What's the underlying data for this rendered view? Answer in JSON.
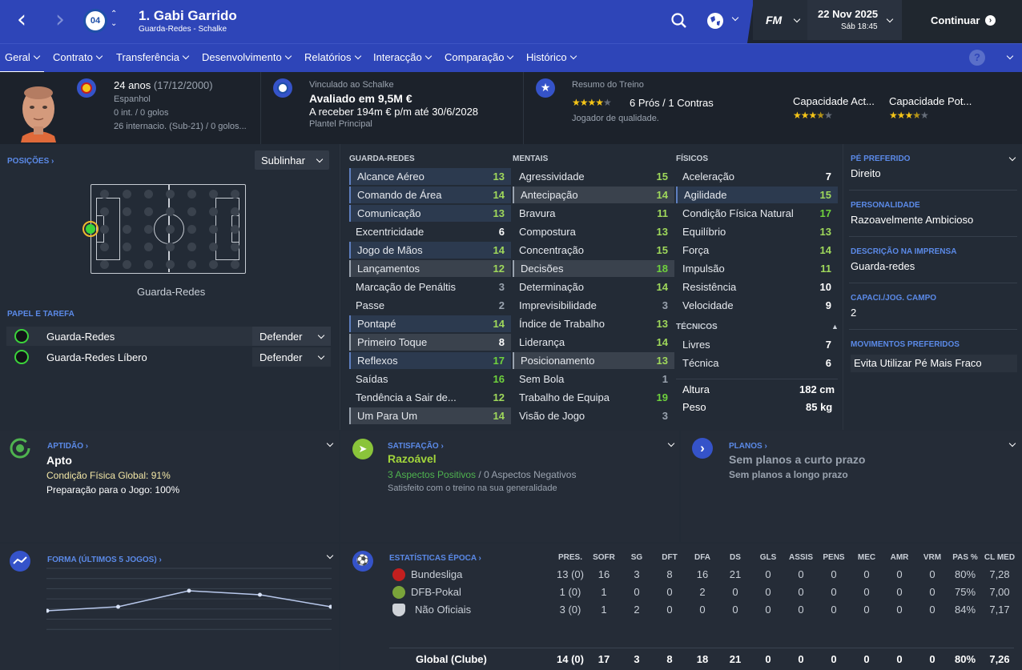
{
  "header": {
    "player_name": "1. Gabi Garrido",
    "subtitle": "Guarda-Redes - Schalke",
    "date": "22 Nov 2025",
    "day_time": "Sáb 18:45",
    "continue": "Continuar",
    "fm": "FM",
    "crest_text": "04"
  },
  "tabs": [
    "Geral",
    "Contrato",
    "Transferência",
    "Desenvolvimento",
    "Relatórios",
    "Interacção",
    "Comparação",
    "Histórico"
  ],
  "profile": {
    "age": "24 anos",
    "dob": "(17/12/2000)",
    "nationality": "Espanhol",
    "caps": "0 int. / 0 golos",
    "youth_caps": "26 internacio. (Sub-21) / 0 golos...",
    "contract_label": "Vinculado ao Schalke",
    "value": "Avaliado em 9,5M €",
    "wage": "A receber 194m € p/m até 30/6/2028",
    "squad": "Plantel Principal",
    "training_label": "Resumo do Treino",
    "pros_cons": "6 Prós / 1 Contras",
    "quality": "Jogador de qualidade.",
    "ca_label": "Capacidade Act...",
    "pa_label": "Capacidade Pot...",
    "training_stars": 3.5,
    "ca_stars": 3.5,
    "pa_stars": 3.5
  },
  "positions": {
    "label": "POSIÇÕES ›",
    "highlight": "Sublinhar",
    "position_name": "Guarda-Redes",
    "role_label": "PAPEL E TAREFA",
    "roles": [
      {
        "role": "Guarda-Redes",
        "duty": "Defender"
      },
      {
        "role": "Guarda-Redes Líbero",
        "duty": "Defender"
      }
    ]
  },
  "attributes": {
    "gk_title": "GUARDA-REDES",
    "mental_title": "MENTAIS",
    "physical_title": "FÍSICOS",
    "technical_title": "TÉCNICOS",
    "gk": [
      [
        "Alcance Aéreo",
        "13"
      ],
      [
        "Comando de Área",
        "14"
      ],
      [
        "Comunicação",
        "13"
      ],
      [
        "Excentricidade",
        "6"
      ],
      [
        "Jogo de Mãos",
        "14"
      ],
      [
        "Lançamentos",
        "12"
      ],
      [
        "Marcação de Penáltis",
        "3"
      ],
      [
        "Passe",
        "2"
      ],
      [
        "Pontapé",
        "14"
      ],
      [
        "Primeiro Toque",
        "8"
      ],
      [
        "Reflexos",
        "17"
      ],
      [
        "Saídas",
        "16"
      ],
      [
        "Tendência a Sair de...",
        "12"
      ],
      [
        "Um Para Um",
        "14"
      ]
    ],
    "mental": [
      [
        "Agressividade",
        "15"
      ],
      [
        "Antecipação",
        "14"
      ],
      [
        "Bravura",
        "11"
      ],
      [
        "Compostura",
        "13"
      ],
      [
        "Concentração",
        "15"
      ],
      [
        "Decisões",
        "18"
      ],
      [
        "Determinação",
        "14"
      ],
      [
        "Imprevisibilidade",
        "3"
      ],
      [
        "Índice de Trabalho",
        "13"
      ],
      [
        "Liderança",
        "14"
      ],
      [
        "Posicionamento",
        "13"
      ],
      [
        "Sem Bola",
        "1"
      ],
      [
        "Trabalho de Equipa",
        "19"
      ],
      [
        "Visão de Jogo",
        "3"
      ]
    ],
    "physical": [
      [
        "Aceleração",
        "7"
      ],
      [
        "Agilidade",
        "15"
      ],
      [
        "Condição Física Natural",
        "17"
      ],
      [
        "Equilíbrio",
        "13"
      ],
      [
        "Força",
        "14"
      ],
      [
        "Impulsão",
        "11"
      ],
      [
        "Resistência",
        "10"
      ],
      [
        "Velocidade",
        "9"
      ]
    ],
    "technical": [
      [
        "Livres",
        "7"
      ],
      [
        "Técnica",
        "6"
      ]
    ],
    "height_label": "Altura",
    "height": "182 cm",
    "weight_label": "Peso",
    "weight": "85 kg"
  },
  "info": [
    {
      "label": "PÉ PREFERIDO",
      "value": "Direito"
    },
    {
      "label": "PERSONALIDADE",
      "value": "Razoavelmente Ambicioso"
    },
    {
      "label": "DESCRIÇÃO NA IMPRENSA",
      "value": "Guarda-redes"
    },
    {
      "label": "CAPACI./JOG. CAMPO",
      "value": "2"
    },
    {
      "label": "MOVIMENTOS PREFERIDOS",
      "value": "Evita Utilizar Pé Mais Fraco"
    }
  ],
  "fitness": {
    "label": "APTIDÃO ›",
    "status": "Apto",
    "condition": "Condição Física Global: 91%",
    "match_prep": "Preparação para o Jogo: 100%"
  },
  "satisfaction": {
    "label": "SATISFAÇÃO ›",
    "status": "Razoável",
    "positives": "3 Aspectos Positivos",
    "sep": " / ",
    "negatives": "0 Aspectos Negativos",
    "note": "Satisfeito com o treino na sua generalidade"
  },
  "plans": {
    "label": "PLANOS ›",
    "short": "Sem planos a curto prazo",
    "long": "Sem planos a longo prazo"
  },
  "form": {
    "label": "FORMA (ÚLTIMOS 5 JOGOS) ›",
    "values": [
      6.9,
      7.0,
      7.4,
      7.3,
      7.0
    ]
  },
  "season": {
    "label": "ESTATÍSTICAS ÉPOCA ›",
    "headers": [
      "PRES.",
      "SOFR",
      "SG",
      "DFT",
      "DFA",
      "DS",
      "GLS",
      "ASSIS",
      "PENS",
      "MEC",
      "AMR",
      "VRM",
      "PAS %",
      "CL MED"
    ],
    "rows": [
      {
        "comp": "Bundesliga",
        "vals": [
          "13 (0)",
          "16",
          "3",
          "8",
          "16",
          "21",
          "0",
          "0",
          "0",
          "0",
          "0",
          "0",
          "80%",
          "7,28"
        ]
      },
      {
        "comp": "DFB-Pokal",
        "vals": [
          "1 (0)",
          "1",
          "0",
          "0",
          "2",
          "0",
          "0",
          "0",
          "0",
          "0",
          "0",
          "0",
          "75%",
          "7,00"
        ]
      },
      {
        "comp": "Não Oficiais",
        "vals": [
          "3 (0)",
          "1",
          "2",
          "0",
          "0",
          "0",
          "0",
          "0",
          "0",
          "0",
          "0",
          "0",
          "84%",
          "7,17"
        ]
      }
    ],
    "total": {
      "comp": "Global (Clube)",
      "vals": [
        "14 (0)",
        "17",
        "3",
        "8",
        "18",
        "21",
        "0",
        "0",
        "0",
        "0",
        "0",
        "0",
        "80%",
        "7,26"
      ]
    }
  }
}
